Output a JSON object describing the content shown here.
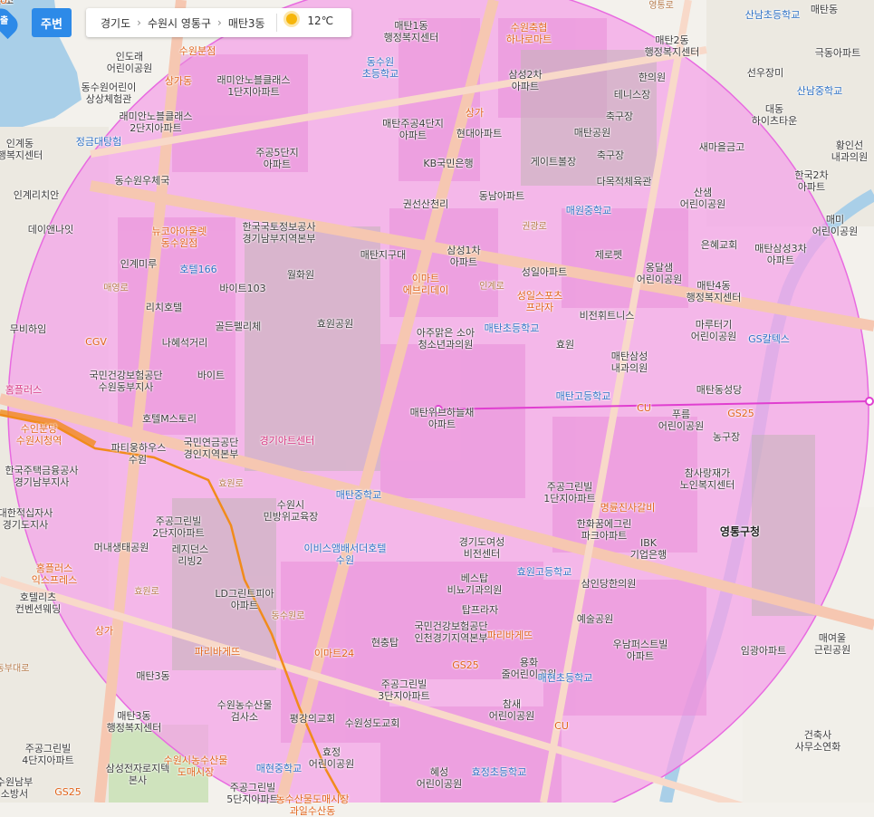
{
  "toolbar": {
    "nearby_label": "주변",
    "breadcrumb": [
      "경기도",
      "수원시 영통구",
      "매탄3동"
    ],
    "temperature": "12℃",
    "location_marker": "출"
  },
  "map": {
    "colors": {
      "radius_fill": "#f4a3e8",
      "radius_stroke": "#e86ae0",
      "water": "#a9cfe8",
      "park": "#cfe3bd"
    },
    "labels": [
      {
        "t": "동수원\n초등학교",
        "c": "blue"
      },
      {
        "t": "매탄1동\n행정복지센터",
        "c": ""
      },
      {
        "t": "수원축협\n하나로마트",
        "c": "orange"
      },
      {
        "t": "매탄2동\n행정복지센터",
        "c": ""
      },
      {
        "t": "산남초등학교",
        "c": "blue"
      },
      {
        "t": "매탄동",
        "c": ""
      },
      {
        "t": "극동아파트",
        "c": ""
      },
      {
        "t": "선우장미",
        "c": ""
      },
      {
        "t": "산남중학교",
        "c": "blue"
      },
      {
        "t": "대동\n하이츠타운",
        "c": ""
      },
      {
        "t": "인도래\n어린이공원",
        "c": ""
      },
      {
        "t": "수원분점",
        "c": "orange"
      },
      {
        "t": "래미안노블클래스\n1단지아파트",
        "c": ""
      },
      {
        "t": "삼성2차\n아파트",
        "c": ""
      },
      {
        "t": "테니스장",
        "c": ""
      },
      {
        "t": "동수원어린이\n상상체험관",
        "c": ""
      },
      {
        "t": "래미안노블클래스\n2단지아파트",
        "c": ""
      },
      {
        "t": "상가동",
        "c": "orange"
      },
      {
        "t": "매탄주공4단지\n아파트",
        "c": ""
      },
      {
        "t": "상가",
        "c": "orange"
      },
      {
        "t": "축구장",
        "c": ""
      },
      {
        "t": "매탄공원",
        "c": ""
      },
      {
        "t": "현대아파트",
        "c": ""
      },
      {
        "t": "인계동\n행복지센터",
        "c": ""
      },
      {
        "t": "정금대탕험",
        "c": "blue"
      },
      {
        "t": "주공5단지\n아파트",
        "c": ""
      },
      {
        "t": "게이트볼장",
        "c": ""
      },
      {
        "t": "축구장",
        "c": ""
      },
      {
        "t": "새마을금고",
        "c": ""
      },
      {
        "t": "황인선\n내과의원",
        "c": ""
      },
      {
        "t": "KB국민은행",
        "c": ""
      },
      {
        "t": "한국2차\n아파트",
        "c": ""
      },
      {
        "t": "동수원우체국",
        "c": ""
      },
      {
        "t": "다목적체육관",
        "c": ""
      },
      {
        "t": "산샘\n어린이공원",
        "c": ""
      },
      {
        "t": "인계리치안",
        "c": ""
      },
      {
        "t": "동남아파트",
        "c": ""
      },
      {
        "t": "매원중학교",
        "c": "blue"
      },
      {
        "t": "매미\n어린이공원",
        "c": ""
      },
      {
        "t": "뉴코아아울렛\n동수원점",
        "c": "orange"
      },
      {
        "t": "한국국토정보공사\n경기남부지역본부",
        "c": ""
      },
      {
        "t": "데이앤나잇",
        "c": ""
      },
      {
        "t": "삼성1차\n아파트",
        "c": ""
      },
      {
        "t": "은혜교회",
        "c": ""
      },
      {
        "t": "매탄삼성3차\n아파트",
        "c": ""
      },
      {
        "t": "제로펫",
        "c": ""
      },
      {
        "t": "옹달샘\n어린이공원",
        "c": ""
      },
      {
        "t": "매탄지구대",
        "c": ""
      },
      {
        "t": "인계미루",
        "c": ""
      },
      {
        "t": "호텔166",
        "c": "blue"
      },
      {
        "t": "월화원",
        "c": ""
      },
      {
        "t": "이마트\n에브리데이",
        "c": "orange"
      },
      {
        "t": "성일아파트",
        "c": ""
      },
      {
        "t": "매탄4동\n행정복지센터",
        "c": ""
      },
      {
        "t": "바이트103",
        "c": ""
      },
      {
        "t": "인계로",
        "c": "road"
      },
      {
        "t": "성일스포츠\n프라자",
        "c": "orange"
      },
      {
        "t": "리치호텔",
        "c": ""
      },
      {
        "t": "비전휘트니스",
        "c": ""
      },
      {
        "t": "무비하임",
        "c": ""
      },
      {
        "t": "골든펠리체",
        "c": ""
      },
      {
        "t": "효원공원",
        "c": ""
      },
      {
        "t": "아주맑은 소아\n청소년과의원",
        "c": ""
      },
      {
        "t": "매탄초등학교",
        "c": "blue"
      },
      {
        "t": "마루터기\n어린이공원",
        "c": ""
      },
      {
        "t": "CGV",
        "c": "orange"
      },
      {
        "t": "나혜석거리",
        "c": ""
      },
      {
        "t": "효원",
        "c": ""
      },
      {
        "t": "매탄삼성\n내과의원",
        "c": ""
      },
      {
        "t": "GS칼텍스",
        "c": "blue"
      },
      {
        "t": "국민건강보험공단\n수원동부지사",
        "c": ""
      },
      {
        "t": "바이트",
        "c": ""
      },
      {
        "t": "홈플러스",
        "c": "pink"
      },
      {
        "t": "매탄고등학교",
        "c": "blue"
      },
      {
        "t": "매탄동성당",
        "c": ""
      },
      {
        "t": "CU",
        "c": "orange"
      },
      {
        "t": "푸름\n어린이공원",
        "c": ""
      },
      {
        "t": "매탄위브하늘채\n아파트",
        "c": ""
      },
      {
        "t": "GS25",
        "c": "orange"
      },
      {
        "t": "수인분당\n수원시청역",
        "c": "orange"
      },
      {
        "t": "호텔M스토리",
        "c": ""
      },
      {
        "t": "국민연금공단\n경인지역본부",
        "c": ""
      },
      {
        "t": "경기아트센터",
        "c": "pink"
      },
      {
        "t": "농구장",
        "c": ""
      },
      {
        "t": "파티웅하우스",
        "c": ""
      },
      {
        "t": "수원",
        "c": ""
      },
      {
        "t": "한국주택금융공사\n경기남부지사",
        "c": ""
      },
      {
        "t": "참사랑재가\n노인복지센터",
        "c": ""
      },
      {
        "t": "효원로",
        "c": "road"
      },
      {
        "t": "주공그린빌\n1단지아파트",
        "c": ""
      },
      {
        "t": "매탄중학교",
        "c": "blue"
      },
      {
        "t": "수원시\n민방위교육장",
        "c": ""
      },
      {
        "t": "대한적십자사\n경기도지사",
        "c": ""
      },
      {
        "t": "명륜진사갈비",
        "c": "orange"
      },
      {
        "t": "주공그린빌\n2단지아파트",
        "c": ""
      },
      {
        "t": "한화꿈에그린\n파크아파트",
        "c": ""
      },
      {
        "t": "IBK\n기업은행",
        "c": ""
      },
      {
        "t": "영통구청",
        "c": "big"
      },
      {
        "t": "머내생태공원",
        "c": ""
      },
      {
        "t": "레지던스\n리빙2",
        "c": ""
      },
      {
        "t": "경기도여성\n비전센터",
        "c": ""
      },
      {
        "t": "홈플러스\n익스프레스",
        "c": "orange"
      },
      {
        "t": "이비스앰배서더호텔\n수원",
        "c": "blue"
      },
      {
        "t": "효원고등학교",
        "c": "blue"
      },
      {
        "t": "베스탑\n비뇨기과의원",
        "c": ""
      },
      {
        "t": "삼인당한의원",
        "c": ""
      },
      {
        "t": "효원로",
        "c": "road"
      },
      {
        "t": "호텔리츠\n컨벤션웨딩",
        "c": ""
      },
      {
        "t": "LD그린트피아\n아파트",
        "c": ""
      },
      {
        "t": "예술공원",
        "c": ""
      },
      {
        "t": "탑프라자",
        "c": ""
      },
      {
        "t": "상가",
        "c": "orange"
      },
      {
        "t": "국민건강보험공단\n인천경기지역본부",
        "c": ""
      },
      {
        "t": "파리바게뜨",
        "c": "orange"
      },
      {
        "t": "우남퍼스트빌\n아파트",
        "c": ""
      },
      {
        "t": "매여울\n근린공원",
        "c": ""
      },
      {
        "t": "파리바게뜨",
        "c": "orange"
      },
      {
        "t": "현충탑",
        "c": ""
      },
      {
        "t": "이마트24",
        "c": "orange"
      },
      {
        "t": "임광아파트",
        "c": ""
      },
      {
        "t": "매탄3동",
        "c": ""
      },
      {
        "t": "용화\n줄어린이공원",
        "c": ""
      },
      {
        "t": "GS25",
        "c": "orange"
      },
      {
        "t": "매현초등학교",
        "c": "blue"
      },
      {
        "t": "주공그린빌\n3단지아파트",
        "c": ""
      },
      {
        "t": "참새\n어린이공원",
        "c": ""
      },
      {
        "t": "수원농수산물\n검사소",
        "c": ""
      },
      {
        "t": "매탄3동\n행정복지센터",
        "c": ""
      },
      {
        "t": "평강의교회",
        "c": ""
      },
      {
        "t": "수원성도교회",
        "c": ""
      },
      {
        "t": "CU",
        "c": "orange"
      },
      {
        "t": "건축사\n사무소연화",
        "c": ""
      },
      {
        "t": "주공그린빌\n4단지아파트",
        "c": ""
      },
      {
        "t": "삼성전자로지텍\n본사",
        "c": ""
      },
      {
        "t": "수원시농수산물\n도매시장",
        "c": "orange"
      },
      {
        "t": "효정\n어린이공원",
        "c": ""
      },
      {
        "t": "효정초등학교",
        "c": "blue"
      },
      {
        "t": "혜성\n어린이공원",
        "c": ""
      },
      {
        "t": "매현중학교",
        "c": "blue"
      },
      {
        "t": "주공그린빌\n5단지아파트",
        "c": ""
      },
      {
        "t": "GS25",
        "c": "orange"
      },
      {
        "t": "수원남부\n소방서",
        "c": ""
      },
      {
        "t": "농수산물도매시장\n과일수산동",
        "c": "orange"
      },
      {
        "t": "한의원",
        "c": ""
      },
      {
        "t": "권선산천리",
        "c": ""
      },
      {
        "t": "매영로",
        "c": "road"
      },
      {
        "t": "동수원로",
        "c": "road"
      },
      {
        "t": "권광로",
        "c": "road"
      },
      {
        "t": "동부대로",
        "c": "road"
      },
      {
        "t": "영통로",
        "c": "road"
      },
      {
        "t": "권선로",
        "c": "road"
      },
      {
        "t": "사무소",
        "c": ""
      },
      {
        "t": "CU",
        "c": "orange"
      }
    ]
  }
}
